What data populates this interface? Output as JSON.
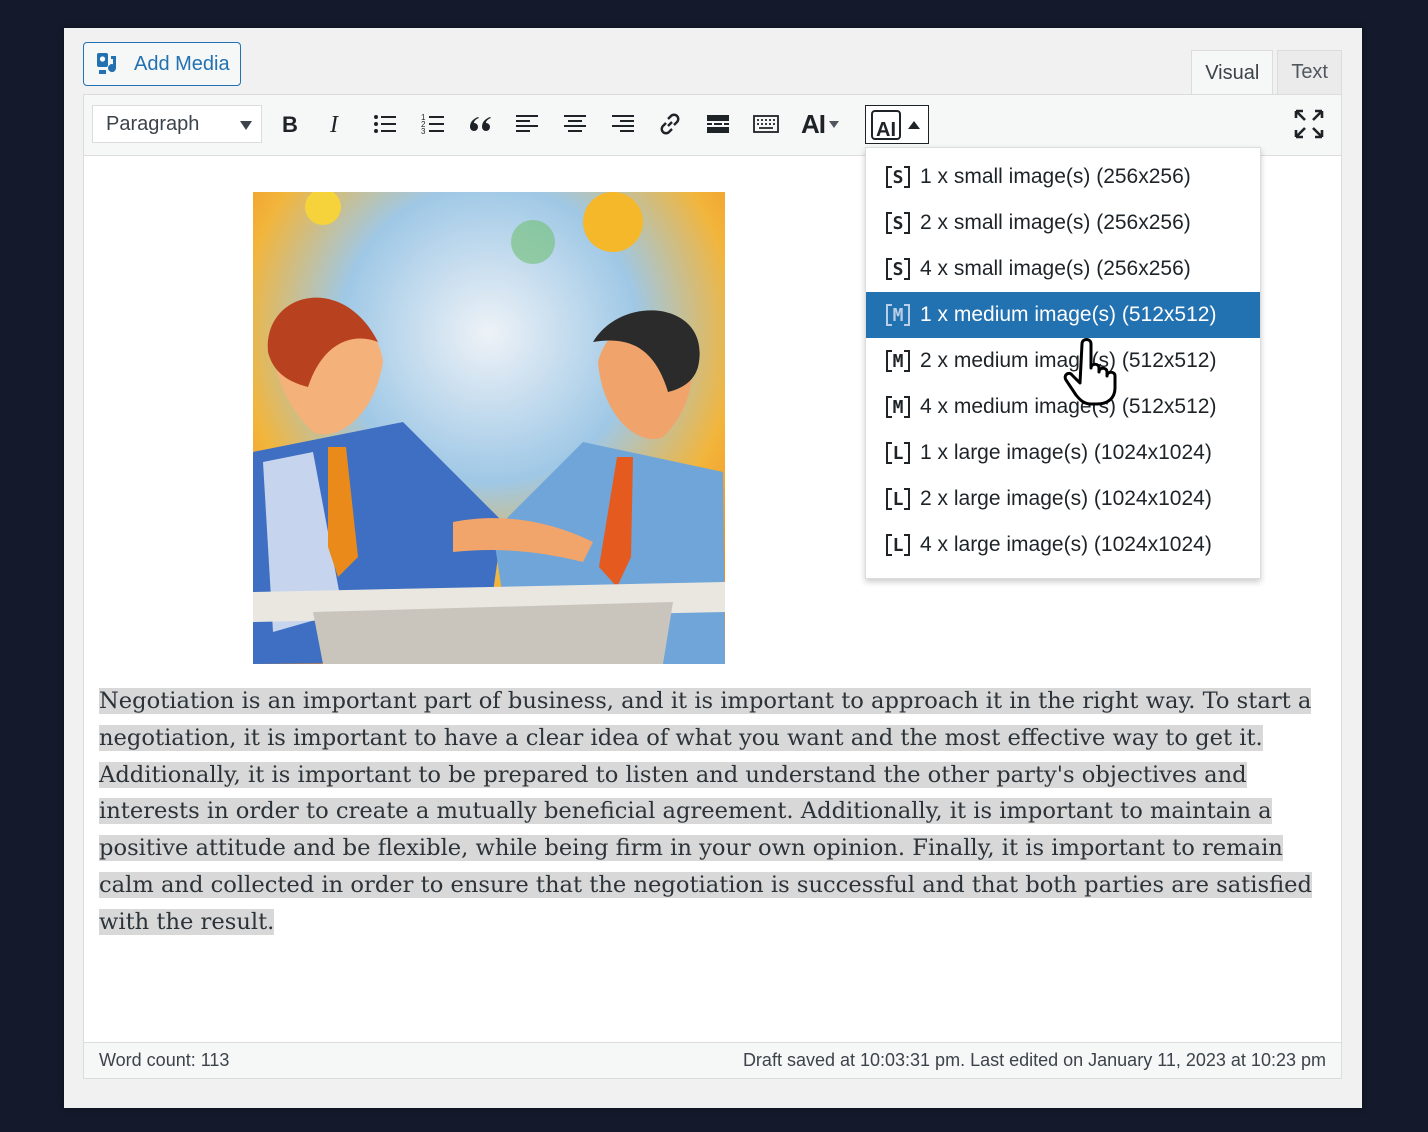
{
  "header": {
    "add_media_label": "Add Media"
  },
  "tabs": [
    {
      "label": "Visual",
      "active": true
    },
    {
      "label": "Text",
      "active": false
    }
  ],
  "toolbar": {
    "format_value": "Paragraph",
    "ai_label": "AI"
  },
  "dropdown": {
    "items": [
      {
        "badge": "S",
        "label": "1 x small image(s) (256x256)",
        "selected": false
      },
      {
        "badge": "S",
        "label": "2 x small image(s) (256x256)",
        "selected": false
      },
      {
        "badge": "S",
        "label": "4 x small image(s) (256x256)",
        "selected": false
      },
      {
        "badge": "M",
        "label": "1 x medium image(s) (512x512)",
        "selected": true
      },
      {
        "badge": "M",
        "label": "2 x medium image(s) (512x512)",
        "selected": false
      },
      {
        "badge": "M",
        "label": "4 x medium image(s) (512x512)",
        "selected": false
      },
      {
        "badge": "L",
        "label": "1 x large image(s) (1024x1024)",
        "selected": false
      },
      {
        "badge": "L",
        "label": "2 x large image(s) (1024x1024)",
        "selected": false
      },
      {
        "badge": "L",
        "label": "4 x large image(s) (1024x1024)",
        "selected": false
      }
    ]
  },
  "content": {
    "paragraph": "Negotiation is an important part of business, and it is important to approach it in the right way. To start a negotiation, it is important to have a clear idea of what you want and the most effective way to get it. Additionally, it is important to be prepared to listen and understand the other party's objectives and interests in order to create a mutually beneficial agreement. Additionally, it is important to maintain a positive attitude and be flexible, while being firm in your own opinion. Finally, it is important to remain calm and collected in order to ensure that the negotiation is successful and that both parties are satisfied with the result."
  },
  "status": {
    "word_count": "Word count: 113",
    "draft_info": "Draft saved at 10:03:31 pm. Last edited on January 11, 2023 at 10:23 pm"
  },
  "colors": {
    "accent": "#2271b1",
    "selected_bg": "#2271b1",
    "highlight": "#d8d8d8"
  }
}
